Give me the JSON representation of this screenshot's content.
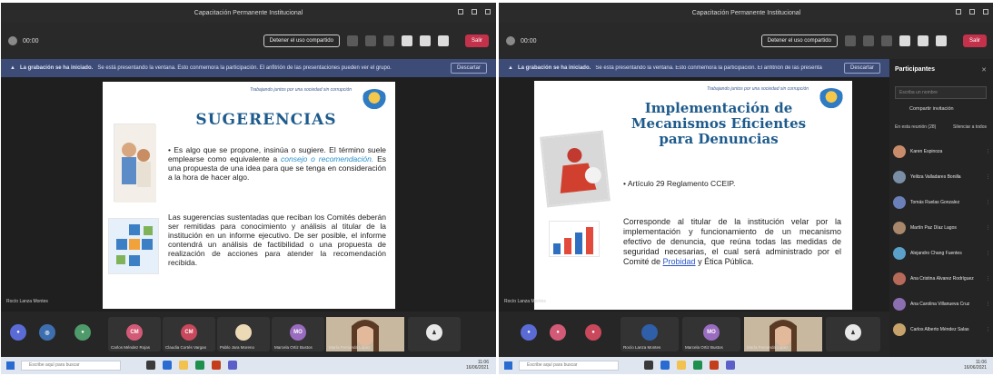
{
  "window_title": "Capacitación Permanente Institucional",
  "meeting": {
    "timer": "00:00",
    "stop_share": "Detener el uso compartido",
    "leave": "Salir"
  },
  "infobar_text": "Se está presentando la ventana. Esto conmemora la participación. El anfitrión de las presentaciones pueden ver el grupo.",
  "infobar_strong": "La grabación se ha iniciado.",
  "infobar_dismiss": "Descartar",
  "slide_left": {
    "tagline": "Trabajando juntos por una sociedad sin corrupción",
    "title": "SUGERENCIAS",
    "bullet_a": "• Es algo que se propone, insinúa o sugiere. El término suele emplearse como equivalente a ",
    "bullet_em": "consejo o recomendación.",
    "bullet_b": " Es una propuesta de una idea para que se tenga en consideración a la hora de hacer algo.",
    "para": "Las sugerencias sustentadas que reciban los Comités deberán ser remitidas para conocimiento y análisis al titular de la institución en un informe ejecutivo. De ser posible, el informe contendrá un análisis de factibilidad o una propuesta de realización de acciones para atender la recomendación recibida."
  },
  "slide_right": {
    "tagline": "Trabajando juntos por una sociedad sin corrupción",
    "title": "Implementación de Mecanismos Eficientes para Denuncias",
    "bullet": "• Artículo 29 Reglamento CCEIP.",
    "para_a": "Corresponde al titular de la institución velar por la implementación y funcionamiento de un mecanismo efectivo de denuncia, que reúna todas las medidas de seguridad necesarias, el cual será administrado por el Comité de ",
    "para_link": "Probidad",
    "para_b": " y Ética Pública."
  },
  "presenter_label_left": "Rocío Lanza Montes",
  "presenter_label_right": "Rocío Lanza Montes",
  "tiles_left": [
    {
      "initials": "CM",
      "name": "Carlos Méndez Rojas"
    },
    {
      "initials": "CM",
      "name": "Claudia Cortés Vargas"
    },
    {
      "initials": "",
      "name": "Pablo Jara Moreno"
    },
    {
      "initials": "MO",
      "name": "Marcela Ortiz Bustos"
    },
    {
      "initials": "",
      "name": "María Fernanda López"
    }
  ],
  "tiles_right": [
    {
      "initials": "",
      "name": "Rocío Lanza Montes"
    },
    {
      "initials": "MO",
      "name": "Marcela Ortiz Bustos"
    },
    {
      "initials": "",
      "name": "María Fernanda López"
    }
  ],
  "taskbar": {
    "search_placeholder": "Escribe aquí para buscar",
    "time": "11:06",
    "date": "16/06/2021"
  },
  "participants_panel": {
    "title": "Participantes",
    "search_placeholder": "Escriba un nombre",
    "share_invite": "Compartir invitación",
    "tab_a": "En esta reunión (28)",
    "tab_b": "Silenciar a todos",
    "people": [
      "Karen Espinoza",
      "Yelitza Valladares Bonilla",
      "Tomás Ruelas Gonzalez",
      "Martín Paz Díaz Lagos",
      "Alejandro Chang Fuentes",
      "Ana Cristina Álvarez Rodríguez",
      "Ana Carolina Villanueva Cruz",
      "Carlos Alberto Méndez Salas"
    ]
  }
}
